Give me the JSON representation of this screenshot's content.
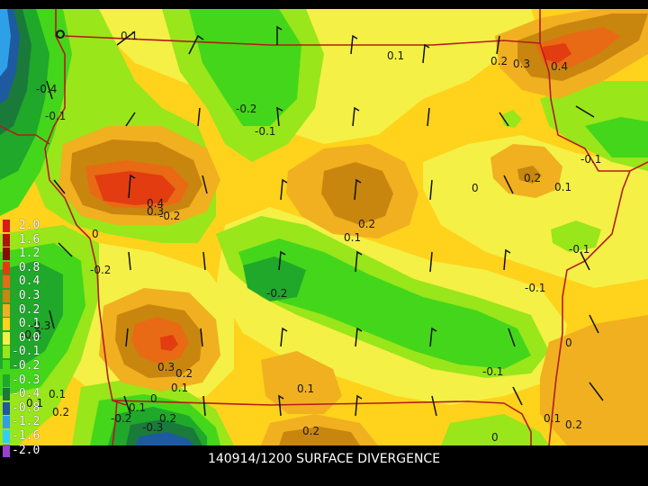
{
  "caption": "140914/1200 SURFACE DIVERGENCE",
  "legend": [
    {
      "label": " 2.0",
      "color": "#d81b1b"
    },
    {
      "label": " 1.6",
      "color": "#b01010"
    },
    {
      "label": " 1.2",
      "color": "#8a0a0a"
    },
    {
      "label": " 0.8",
      "color": "#e23c10"
    },
    {
      "label": " 0.4",
      "color": "#e86a14"
    },
    {
      "label": " 0.3",
      "color": "#c8860f"
    },
    {
      "label": " 0.2",
      "color": "#f0b020"
    },
    {
      "label": " 0.1",
      "color": "#ffd21c"
    },
    {
      "label": " 0.0",
      "color": "#f4f046"
    },
    {
      "label": "-0.1",
      "color": "#99e61a"
    },
    {
      "label": "-0.2",
      "color": "#44d61a"
    },
    {
      "label": "-0.3",
      "color": "#1fa82a"
    },
    {
      "label": "-0.4",
      "color": "#1a7a3a"
    },
    {
      "label": "-0.8",
      "color": "#1e5aa0"
    },
    {
      "label": "-1.2",
      "color": "#2ea0e8"
    },
    {
      "label": "-1.6",
      "color": "#30d0f0"
    },
    {
      "label": "-2.0",
      "color": "#9a40d0"
    }
  ],
  "contour_labels": [
    "0.1",
    "-0.4",
    "-0.1",
    "-0.2",
    "-0.1",
    "0.1",
    "0.2",
    "0.3",
    "0.4",
    "-0.1",
    "0",
    "0.2",
    "0.1",
    "0.4",
    "0.3",
    "-0.2",
    "0",
    "0.2",
    "0.1",
    "-0.1",
    "-0.2",
    "-0.1",
    "-0.2",
    "-0.2",
    "-0.3",
    "0.3",
    "0.2",
    "0.1",
    "0",
    "0.1",
    "0",
    "-0.1",
    "0.1",
    "0.1",
    "0.2",
    "0.1",
    "0.2",
    "-0.3",
    "-0.2",
    "0.2",
    "0",
    "0.1",
    "0.2"
  ]
}
